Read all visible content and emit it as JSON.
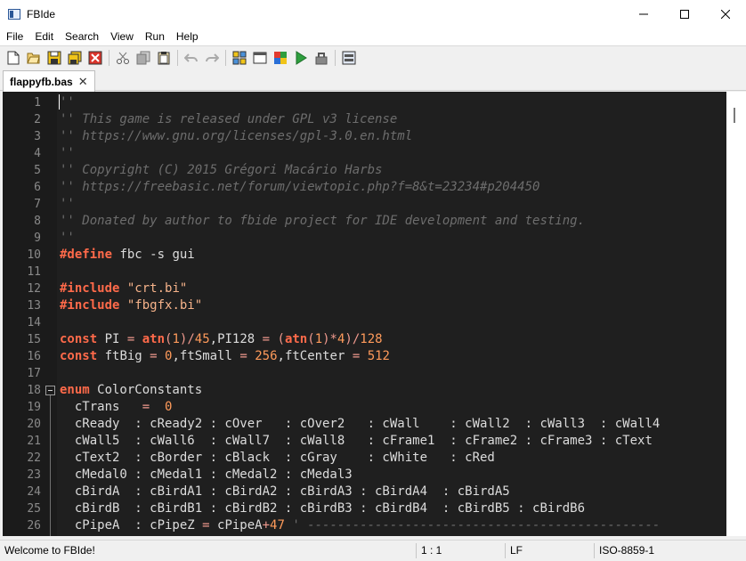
{
  "window": {
    "title": "FBIde"
  },
  "menu": [
    "File",
    "Edit",
    "Search",
    "View",
    "Run",
    "Help"
  ],
  "toolbar": {
    "groups": [
      [
        "new-file-icon",
        "open-file-icon",
        "save-icon",
        "save-all-icon",
        "close-file-icon"
      ],
      [
        "cut-icon",
        "copy-icon",
        "paste-icon"
      ],
      [
        "undo-icon",
        "redo-icon"
      ],
      [
        "sub-list-icon",
        "output-icon",
        "compile-icon",
        "run-icon",
        "compile-run-icon"
      ],
      [
        "settings-icon"
      ]
    ]
  },
  "tabs": [
    {
      "label": "flappyfb.bas",
      "close": "✕"
    }
  ],
  "editor": {
    "fold_marker_line": 18,
    "lines": [
      {
        "n": "1",
        "tokens": [
          {
            "t": "''",
            "c": "comment"
          }
        ]
      },
      {
        "n": "2",
        "tokens": [
          {
            "t": "'' This game is released under GPL v3 license",
            "c": "comment"
          }
        ]
      },
      {
        "n": "3",
        "tokens": [
          {
            "t": "'' https://www.gnu.org/licenses/gpl-3.0.en.html",
            "c": "comment"
          }
        ]
      },
      {
        "n": "4",
        "tokens": [
          {
            "t": "''",
            "c": "comment"
          }
        ]
      },
      {
        "n": "5",
        "tokens": [
          {
            "t": "'' Copyright (C) 2015 Grégori Macário Harbs",
            "c": "comment"
          }
        ]
      },
      {
        "n": "6",
        "tokens": [
          {
            "t": "'' https://freebasic.net/forum/viewtopic.php?f=8&t=23234#p204450",
            "c": "comment"
          }
        ]
      },
      {
        "n": "7",
        "tokens": [
          {
            "t": "''",
            "c": "comment"
          }
        ]
      },
      {
        "n": "8",
        "tokens": [
          {
            "t": "'' Donated by author to fbide project for IDE development and testing.",
            "c": "comment"
          }
        ]
      },
      {
        "n": "9",
        "tokens": [
          {
            "t": "''",
            "c": "comment"
          }
        ]
      },
      {
        "n": "10",
        "tokens": [
          {
            "t": "#define",
            "c": "kw"
          },
          {
            "t": " fbc -s gui",
            "c": "text"
          }
        ]
      },
      {
        "n": "11",
        "tokens": []
      },
      {
        "n": "12",
        "tokens": [
          {
            "t": "#include",
            "c": "kw"
          },
          {
            "t": " ",
            "c": "text"
          },
          {
            "t": "\"crt.bi\"",
            "c": "str"
          }
        ]
      },
      {
        "n": "13",
        "tokens": [
          {
            "t": "#include",
            "c": "kw"
          },
          {
            "t": " ",
            "c": "text"
          },
          {
            "t": "\"fbgfx.bi\"",
            "c": "str"
          }
        ]
      },
      {
        "n": "14",
        "tokens": []
      },
      {
        "n": "15",
        "tokens": [
          {
            "t": "const",
            "c": "kw"
          },
          {
            "t": " PI ",
            "c": "text"
          },
          {
            "t": "=",
            "c": "op"
          },
          {
            "t": " ",
            "c": "text"
          },
          {
            "t": "atn",
            "c": "fn"
          },
          {
            "t": "(",
            "c": "op"
          },
          {
            "t": "1",
            "c": "num"
          },
          {
            "t": ")/",
            "c": "op"
          },
          {
            "t": "45",
            "c": "num"
          },
          {
            "t": ",PI128 ",
            "c": "text"
          },
          {
            "t": "=",
            "c": "op"
          },
          {
            "t": " (",
            "c": "op"
          },
          {
            "t": "atn",
            "c": "fn"
          },
          {
            "t": "(",
            "c": "op"
          },
          {
            "t": "1",
            "c": "num"
          },
          {
            "t": ")*",
            "c": "op"
          },
          {
            "t": "4",
            "c": "num"
          },
          {
            "t": ")/",
            "c": "op"
          },
          {
            "t": "128",
            "c": "num"
          }
        ]
      },
      {
        "n": "16",
        "tokens": [
          {
            "t": "const",
            "c": "kw"
          },
          {
            "t": " ftBig ",
            "c": "text"
          },
          {
            "t": "=",
            "c": "op"
          },
          {
            "t": " ",
            "c": "text"
          },
          {
            "t": "0",
            "c": "num"
          },
          {
            "t": ",ftSmall ",
            "c": "text"
          },
          {
            "t": "=",
            "c": "op"
          },
          {
            "t": " ",
            "c": "text"
          },
          {
            "t": "256",
            "c": "num"
          },
          {
            "t": ",ftCenter ",
            "c": "text"
          },
          {
            "t": "=",
            "c": "op"
          },
          {
            "t": " ",
            "c": "text"
          },
          {
            "t": "512",
            "c": "num"
          }
        ]
      },
      {
        "n": "17",
        "tokens": []
      },
      {
        "n": "18",
        "tokens": [
          {
            "t": "enum",
            "c": "kw"
          },
          {
            "t": " ColorConstants",
            "c": "text"
          }
        ]
      },
      {
        "n": "19",
        "tokens": [
          {
            "t": "  cTrans   ",
            "c": "text"
          },
          {
            "t": "=",
            "c": "op"
          },
          {
            "t": "  ",
            "c": "text"
          },
          {
            "t": "0",
            "c": "num"
          }
        ]
      },
      {
        "n": "20",
        "tokens": [
          {
            "t": "  cReady  : cReady2 : cOver   : cOver2   : cWall    : cWall2  : cWall3  : cWall4",
            "c": "text"
          }
        ]
      },
      {
        "n": "21",
        "tokens": [
          {
            "t": "  cWall5  : cWall6  : cWall7  : cWall8   : cFrame1  : cFrame2 : cFrame3 : cText",
            "c": "text"
          }
        ]
      },
      {
        "n": "22",
        "tokens": [
          {
            "t": "  cText2  : cBorder : cBlack  : cGray    : cWhite   : cRed",
            "c": "text"
          }
        ]
      },
      {
        "n": "23",
        "tokens": [
          {
            "t": "  cMedal0 : cMedal1 : cMedal2 : cMedal3",
            "c": "text"
          }
        ]
      },
      {
        "n": "24",
        "tokens": [
          {
            "t": "  cBirdA  : cBirdA1 : cBirdA2 : cBirdA3 : cBirdA4  : cBirdA5",
            "c": "text"
          }
        ]
      },
      {
        "n": "25",
        "tokens": [
          {
            "t": "  cBirdB  : cBirdB1 : cBirdB2 : cBirdB3 : cBirdB4  : cBirdB5 : cBirdB6",
            "c": "text"
          }
        ]
      },
      {
        "n": "26",
        "tokens": [
          {
            "t": "  cPipeA  : cPipeZ ",
            "c": "text"
          },
          {
            "t": "=",
            "c": "op"
          },
          {
            "t": " cPipeA",
            "c": "text"
          },
          {
            "t": "+",
            "c": "op"
          },
          {
            "t": "47",
            "c": "num"
          },
          {
            "t": " ' -----------------------------------------------",
            "c": "comment"
          }
        ]
      }
    ]
  },
  "status": {
    "message": "Welcome to FBIde!",
    "position": "1 : 1",
    "eol": "LF",
    "encoding": "ISO-8859-1"
  },
  "colors": {
    "editor_bg": "#1f1f1f",
    "comment": "#6d6d6d",
    "keyword": "#ff6a4a",
    "string": "#f6b38a",
    "number": "#ff9b5b",
    "text": "#dcdcdc"
  }
}
